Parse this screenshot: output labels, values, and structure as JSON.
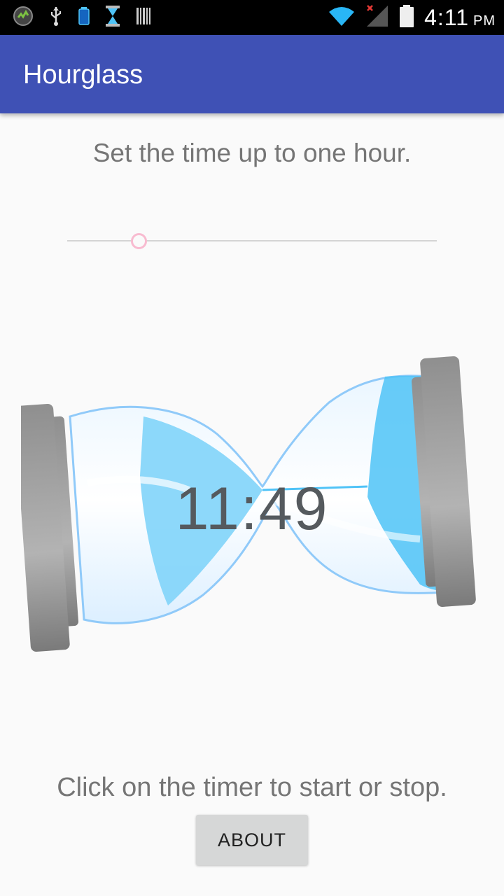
{
  "status_bar": {
    "time": "4:11",
    "ampm": "PM",
    "left_icons": [
      "app-badge-icon",
      "usb-icon",
      "battery-small-icon",
      "hourglass-small-icon",
      "barcode-icon"
    ],
    "right_icons": [
      "wifi-icon",
      "signal-icon",
      "battery-icon"
    ]
  },
  "app_bar": {
    "title": "Hourglass"
  },
  "main": {
    "instruction_top": "Set the time up to one hour.",
    "slider": {
      "value_fraction": 0.195,
      "accent_color": "#f8bbd0"
    },
    "timer": "11:49",
    "instruction_bottom": "Click on the timer to start or stop.",
    "about_label": "ABOUT"
  },
  "colors": {
    "app_bar": "#3f51b5",
    "background": "#fafafa",
    "text_secondary": "#757575",
    "sand": "#81d4fa"
  }
}
